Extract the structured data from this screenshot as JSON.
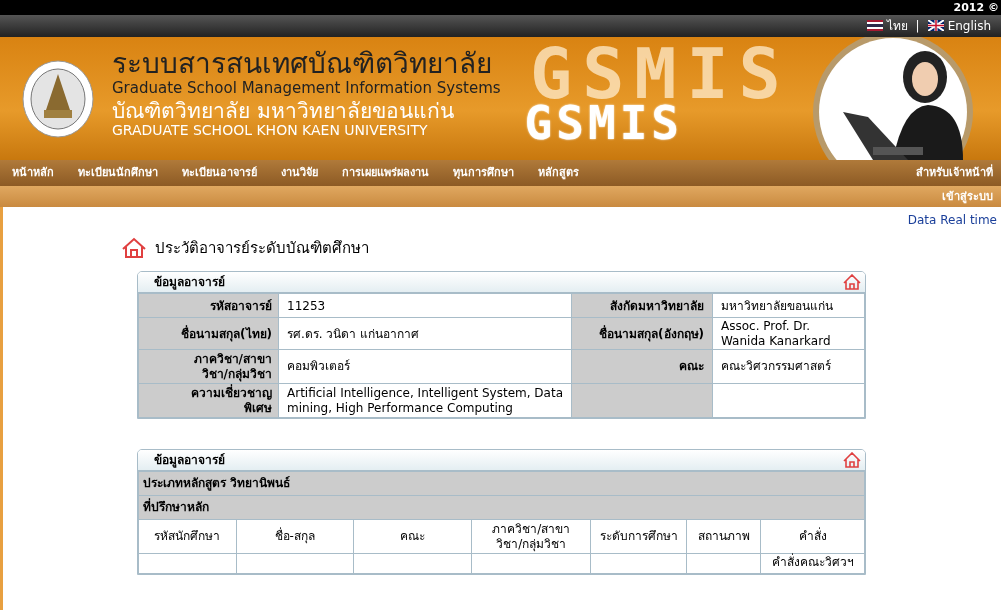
{
  "top_bar": {
    "copyright": "2012 ©"
  },
  "languages": [
    {
      "label": "ไทย",
      "kind": "thai"
    },
    {
      "label": "English",
      "kind": "uk"
    }
  ],
  "language_separator": "|",
  "header": {
    "title_thai": "ระบบสารสนเทศบัณฑิตวิทยาลัย",
    "title_english": "Graduate School Management Information Systems",
    "school_thai": "บัณฑิตวิทยาลัย มหาวิทยาลัยขอนแก่น",
    "school_english": "GRADUATE SCHOOL KHON KAEN UNIVERSITY",
    "logo_text": "GSMIS",
    "background_text": "GSMIS"
  },
  "nav": [
    "หน้าหลัก",
    "ทะเบียนนักศึกษา",
    "ทะเบียนอาจารย์",
    "งานวิจัย",
    "การเผยแพร่ผลงาน",
    "ทุนการศึกษา",
    "หลักสูตร"
  ],
  "nav_right": "สำหรับเจ้าหน้าที่",
  "login": "เข้าสู่ระบบ",
  "realtime_link": "Data Real time",
  "page_title": "ประวัติอาจารย์ระดับบัณฑิตศึกษา",
  "profile": {
    "title": "ข้อมูลอาจารย์",
    "rows": [
      {
        "label": "รหัสอาจารย์",
        "value": "11253",
        "label_2": "สังกัดมหาวิทยาลัย",
        "value_2": "มหาวิทยาลัยขอนแก่น"
      },
      {
        "label": "ชื่อนามสกุล(ไทย)",
        "value": "รศ.ดร. วนิดา แก่นอากาศ",
        "label_2": "ชื่อนามสกุล(อังกฤษ)",
        "value_2": "Assoc. Prof. Dr. Wanida Kanarkard"
      },
      {
        "label": "ภาควิชา/สาขาวิชา/กลุ่มวิชา",
        "value": "คอมพิวเตอร์",
        "label_2": "คณะ",
        "value_2": "คณะวิศวกรรมศาสตร์"
      },
      {
        "label": "ความเชี่ยวชาญพิเศษ",
        "value": "Artificial Intelligence, Intelligent System, Data mining, High Performance Computing"
      }
    ]
  },
  "advising": {
    "title": "ข้อมูลอาจารย์",
    "sections": [
      "ประเภทหลักสูตร วิทยานิพนธ์",
      "ที่ปรึกษาหลัก"
    ],
    "columns": [
      "รหัสนักศึกษา",
      "ชื่อ-สกุล",
      "คณะ",
      "ภาควิชา/สาขาวิชา/กลุ่มวิชา",
      "ระดับการศึกษา",
      "สถานภาพ",
      "คำสั่ง"
    ],
    "rows": [
      {
        "column_7": "คำสั่งคณะวิศวฯ"
      }
    ]
  }
}
